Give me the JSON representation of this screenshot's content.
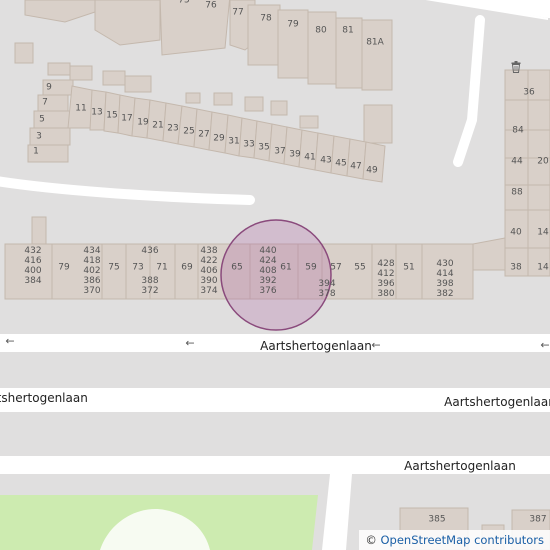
{
  "map": {
    "background": "#e0dfdf",
    "building_fill": "#d9d0c9",
    "building_stroke": "#c4b8ad",
    "road_color": "#ffffff",
    "park_color": "#cdebb0",
    "marker_color": "#b066a0"
  },
  "streets": {
    "a1": "Aartshertogenlaan",
    "a2": "Aartshertogenlaan",
    "a3": "Aartshertogenlaan",
    "a4": "Aartshertogenlaan"
  },
  "arrows": {
    "glyph": "←"
  },
  "house_numbers": {
    "n75": "75",
    "n76": "76",
    "n77": "77",
    "n78": "78",
    "n79": "79",
    "n80": "80",
    "n81": "81",
    "n81a": "81A",
    "n9": "9",
    "n7": "7",
    "n5": "5",
    "n3": "3",
    "n1": "1",
    "n11": "11",
    "n13": "13",
    "n15": "15",
    "n17": "17",
    "n19": "19",
    "n21": "21",
    "n23": "23",
    "n25": "25",
    "n27": "27",
    "n29": "29",
    "n31": "31",
    "n33": "33",
    "n35": "35",
    "n37": "37",
    "n39": "39",
    "n41": "41",
    "n43": "43",
    "n45": "45",
    "n47": "47",
    "n49": "49",
    "n36": "36",
    "n84": "84",
    "n44": "44",
    "n20": "20",
    "n88": "88",
    "n40": "40",
    "n14a": "14",
    "n38": "38",
    "n14b": "14",
    "n79b": "79",
    "n75b": "75",
    "n73": "73",
    "n71": "71",
    "n69": "69",
    "n65": "65",
    "n61": "61",
    "n59": "59",
    "n57": "57",
    "n55": "55",
    "n51": "51",
    "c432": [
      "432",
      "416",
      "400",
      "384"
    ],
    "c434": [
      "434",
      "418",
      "402",
      "386",
      "370"
    ],
    "c436": [
      "436",
      "",
      "",
      "388",
      "372"
    ],
    "c438": [
      "438",
      "422",
      "406",
      "390",
      "374"
    ],
    "c440": [
      "440",
      "424",
      "408",
      "392",
      "376"
    ],
    "c394": [
      "394",
      "378"
    ],
    "c428": [
      "428",
      "412",
      "396",
      "380"
    ],
    "c430": [
      "430",
      "414",
      "398",
      "382"
    ],
    "n385": "385",
    "n387": "387"
  },
  "icons": {
    "waste_basket": "waste-basket-icon"
  },
  "attribution": {
    "symbol": "©",
    "text": "OpenStreetMap contributors"
  }
}
